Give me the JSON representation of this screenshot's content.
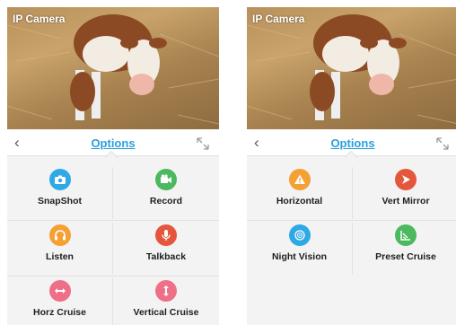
{
  "left_screen": {
    "camera_title": "IP Camera",
    "options_title": "Options",
    "items": [
      {
        "label": "SnapShot",
        "color": "#2fa8e6",
        "icon": "camera-icon"
      },
      {
        "label": "Record",
        "color": "#4cb85f",
        "icon": "video-camera-icon"
      },
      {
        "label": "Listen",
        "color": "#f5a033",
        "icon": "headphones-icon"
      },
      {
        "label": "Talkback",
        "color": "#e4573d",
        "icon": "microphone-icon"
      },
      {
        "label": "Horz Cruise",
        "color": "#ef6f87",
        "icon": "horizontal-arrows-icon"
      },
      {
        "label": "Vertical Cruise",
        "color": "#ef6f87",
        "icon": "vertical-arrows-icon"
      }
    ]
  },
  "right_screen": {
    "camera_title": "IP Camera",
    "options_title": "Options",
    "items": [
      {
        "label": "Horizontal",
        "color": "#f5a033",
        "icon": "warning-triangle-icon"
      },
      {
        "label": "Vert Mirror",
        "color": "#e4573d",
        "icon": "play-arrow-icon"
      },
      {
        "label": "Night Vision",
        "color": "#2fa8e6",
        "icon": "night-vision-icon"
      },
      {
        "label": "Preset Cruise",
        "color": "#4cb85f",
        "icon": "preset-cruise-icon"
      }
    ]
  }
}
